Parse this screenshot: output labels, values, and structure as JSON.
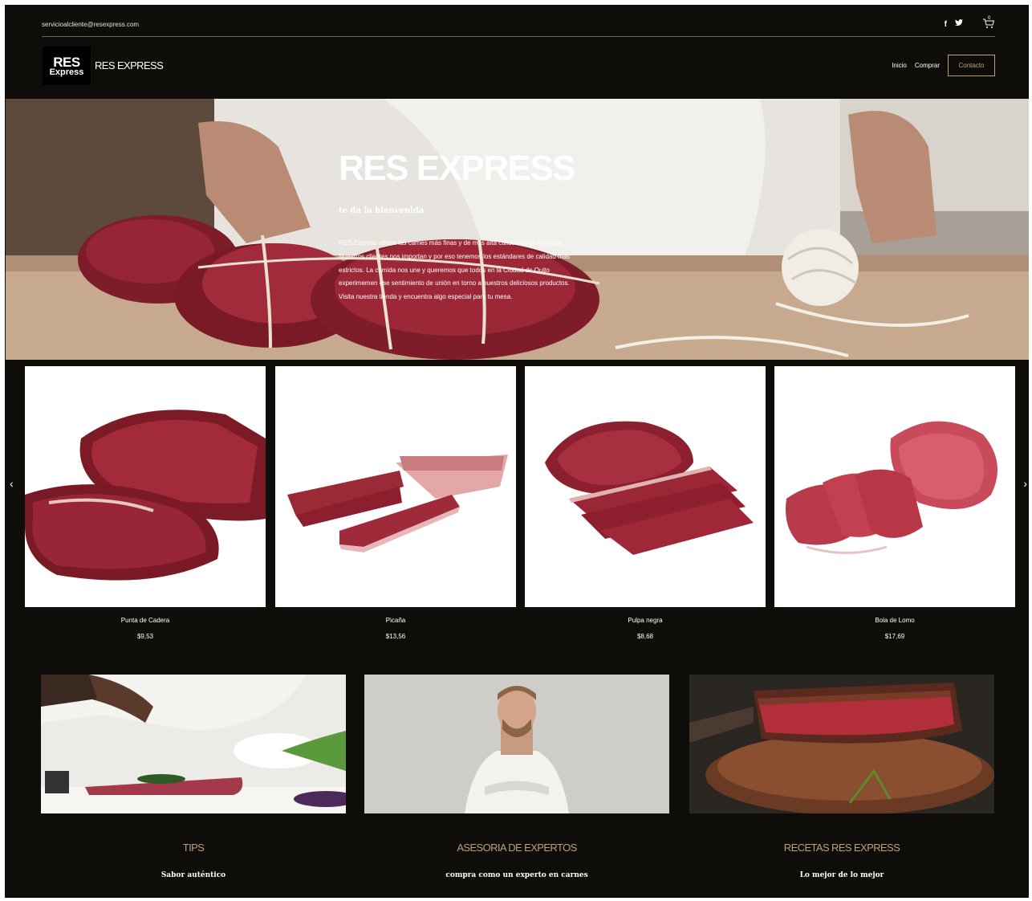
{
  "topbar": {
    "email": "servicioalcliente@resexpress.com",
    "social": [
      {
        "icon": "facebook-icon",
        "glyph": "f"
      },
      {
        "icon": "twitter-icon",
        "glyph": "t"
      }
    ],
    "cart": {
      "icon": "cart-icon",
      "count": "0"
    }
  },
  "header": {
    "logo_top": "RES",
    "logo_bottom": "Express",
    "brand": "RES EXPRESS",
    "nav": {
      "inicio": "Inicio",
      "comprar": "Comprar",
      "contacto": "Contacto"
    }
  },
  "hero": {
    "title": "RES EXPRESS",
    "subtitle": "te da la bienvenida",
    "body": "RES Express ofrece las carnes más finas y de más alta calidad en el mercado. Nuestros clientes nos importan y por eso tenemos los estándares de calidad más estrictos. La comida nos une y queremos que todos en la Ciudad de Quito experimemen ese sentimiento de unión en torno a nuestros deliciosos productos. Visita nuestra tienda y encuentra algo especial para tu mesa."
  },
  "products": {
    "prev_icon": "chevron-left-icon",
    "next_icon": "chevron-right-icon",
    "items": [
      {
        "name": "Punta de Cadera",
        "price": "$9,53"
      },
      {
        "name": "Picaña",
        "price": "$13,56"
      },
      {
        "name": "Pulpa negra",
        "price": "$8,68"
      },
      {
        "name": "Bola de Lomo",
        "price": "$17,69"
      }
    ]
  },
  "features": [
    {
      "title": "TIPS",
      "subtitle": "Sabor auténtico"
    },
    {
      "title": "ASESORIA DE EXPERTOS",
      "subtitle": "compra como un experto en carnes"
    },
    {
      "title": "RECETAS RES EXPRESS",
      "subtitle": "Lo mejor de lo mejor"
    }
  ],
  "colors": {
    "background": "#0e0d0a",
    "accent": "#b9a27a",
    "meat": "#8e1f2c"
  }
}
